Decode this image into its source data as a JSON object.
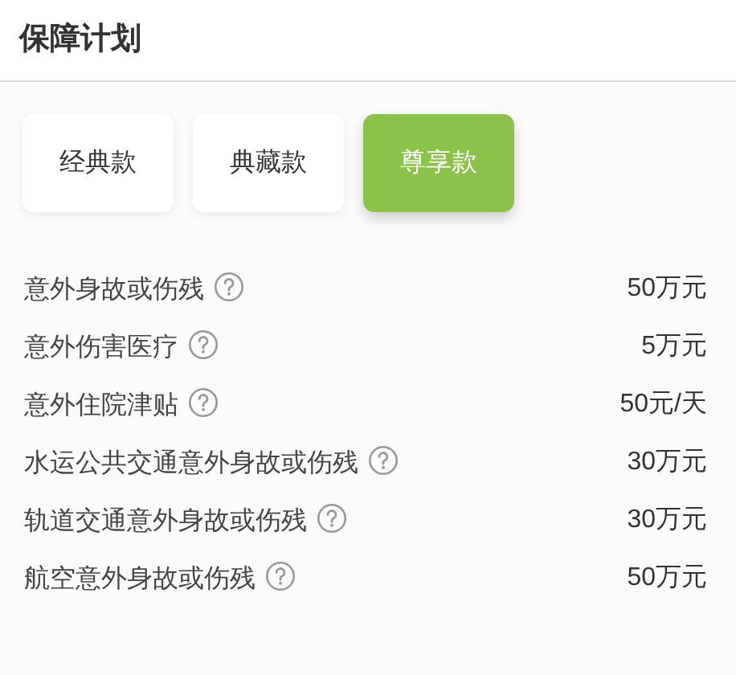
{
  "header": {
    "title": "保障计划"
  },
  "plans": [
    {
      "label": "经典款",
      "selected": false
    },
    {
      "label": "典藏款",
      "selected": false
    },
    {
      "label": "尊享款",
      "selected": true
    }
  ],
  "coverage": [
    {
      "name": "意外身故或伤残",
      "amount": "50万元"
    },
    {
      "name": "意外伤害医疗",
      "amount": "5万元"
    },
    {
      "name": "意外住院津贴",
      "amount": "50元/天"
    },
    {
      "name": "水运公共交通意外身故或伤残",
      "amount": "30万元"
    },
    {
      "name": "轨道交通意外身故或伤残",
      "amount": "30万元"
    },
    {
      "name": "航空意外身故或伤残",
      "amount": "50万元"
    }
  ]
}
